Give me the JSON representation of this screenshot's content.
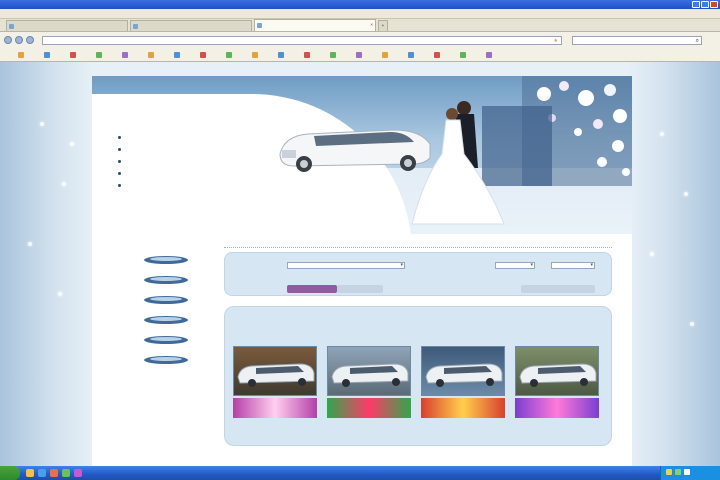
{
  "browser": {
    "title": "",
    "menu": [
      "",
      "",
      "",
      "",
      "",
      ""
    ],
    "tabs": [
      {
        "label": "",
        "active": false
      },
      {
        "label": "",
        "active": false
      },
      {
        "label": "",
        "active": true
      }
    ],
    "url": "",
    "bookmarks": [
      "",
      "",
      "",
      "",
      "",
      "",
      "",
      "",
      "",
      "",
      "",
      "",
      "",
      "",
      "",
      "",
      "",
      "",
      ""
    ]
  },
  "site": {
    "slogan": "",
    "menu": [
      {
        "label": ""
      },
      {
        "label": ""
      },
      {
        "label": ""
      },
      {
        "label": ""
      },
      {
        "label": ""
      }
    ],
    "phones": [
      "",
      "",
      ""
    ],
    "left_links": [
      "",
      "",
      ""
    ],
    "catalog_title": "",
    "catalog_items": [
      "",
      "",
      "",
      "",
      "",
      ""
    ],
    "subnav": [
      "",
      "",
      "",
      "",
      "",
      "",
      ""
    ],
    "filter": {
      "field1_label": "",
      "field2_label": "",
      "from_label": "",
      "to_label": "",
      "search_button": "",
      "reset_button": "",
      "advanced_button": ""
    },
    "heading": "",
    "offers_title": "",
    "offers": [
      {
        "line1": "",
        "line2": "",
        "badge": ""
      },
      {
        "line1": "",
        "line2": "",
        "badge": ""
      },
      {
        "line1": "",
        "line2": "",
        "badge": ""
      },
      {
        "line1": "",
        "line2": "",
        "badge": ""
      }
    ]
  },
  "colors": {
    "accent_purple": "#8f5c9f",
    "link_blue": "#2a6bb8",
    "heading_navy": "#1f3d62",
    "taskbar_blue": "#2359c5",
    "badge_red": "#cf2f2f"
  }
}
